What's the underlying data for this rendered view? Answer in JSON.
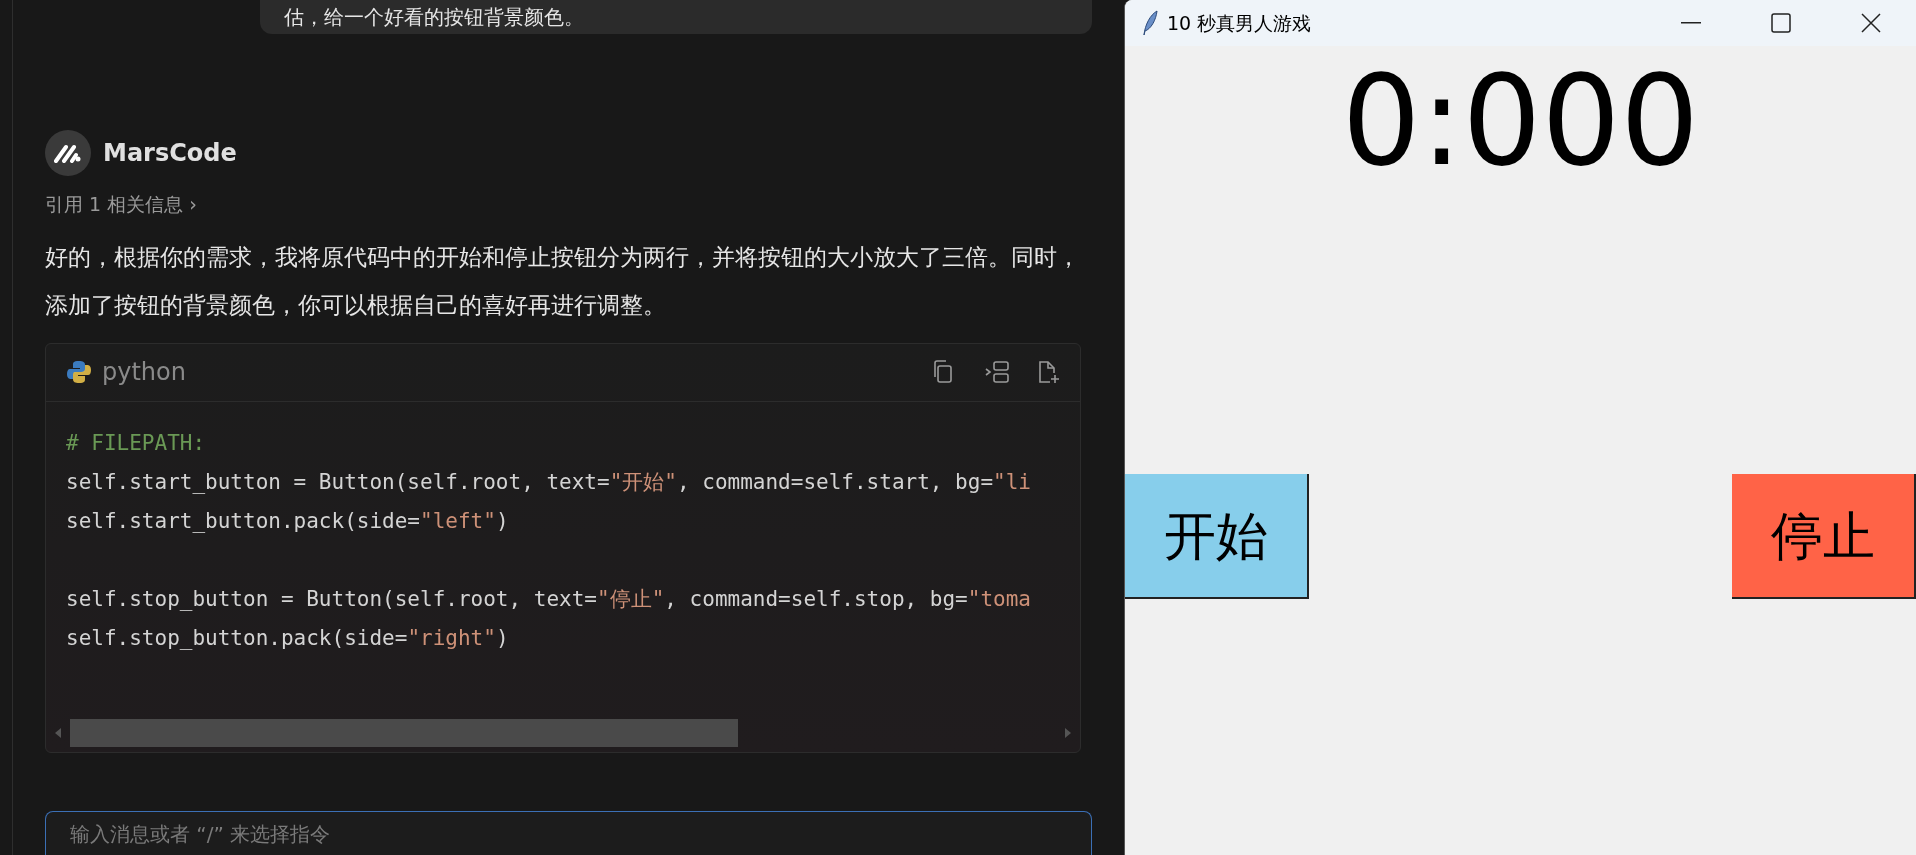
{
  "chat": {
    "user_message": "估，给一个好看的按钮背景颜色。",
    "assistant": {
      "name": "MarsCode",
      "reference": "引用 1 相关信息 ›",
      "reply": "好的，根据你的需求，我将原代码中的开始和停止按钮分为两行，并将按钮的大小放大了三倍。同时，添加了按钮的背景颜色，你可以根据自己的喜好再进行调整。",
      "code_block": {
        "language": "python",
        "lines": [
          {
            "kind": "code",
            "segments": [
              {
                "kind": "comment",
                "text": "# FILEPATH:"
              }
            ]
          },
          {
            "kind": "code",
            "segments": [
              {
                "kind": "plain",
                "text": "self.start_button = Button(self.root, text="
              },
              {
                "kind": "string",
                "text": "\"开始\""
              },
              {
                "kind": "plain",
                "text": ", command=self.start, bg="
              },
              {
                "kind": "string",
                "text": "\"li"
              }
            ]
          },
          {
            "kind": "code",
            "segments": [
              {
                "kind": "plain",
                "text": "self.start_button.pack(side="
              },
              {
                "kind": "string",
                "text": "\"left\""
              },
              {
                "kind": "plain",
                "text": ")"
              }
            ]
          },
          {
            "kind": "blank"
          },
          {
            "kind": "code",
            "segments": [
              {
                "kind": "plain",
                "text": "self.stop_button = Button(self.root, text="
              },
              {
                "kind": "string",
                "text": "\"停止\""
              },
              {
                "kind": "plain",
                "text": ", command=self.stop, bg="
              },
              {
                "kind": "string",
                "text": "\"toma"
              }
            ]
          },
          {
            "kind": "code",
            "segments": [
              {
                "kind": "plain",
                "text": "self.stop_button.pack(side="
              },
              {
                "kind": "string",
                "text": "\"right\""
              },
              {
                "kind": "plain",
                "text": ")"
              }
            ]
          }
        ]
      }
    },
    "input": {
      "placeholder": "输入消息或者 “/” 来选择指令"
    }
  },
  "game_window": {
    "title": "10 秒真男人游戏",
    "timer": "0:000",
    "buttons": [
      {
        "label": "开始",
        "color": "#87ceeb"
      },
      {
        "label": "停止",
        "color": "#ff6347"
      }
    ]
  }
}
